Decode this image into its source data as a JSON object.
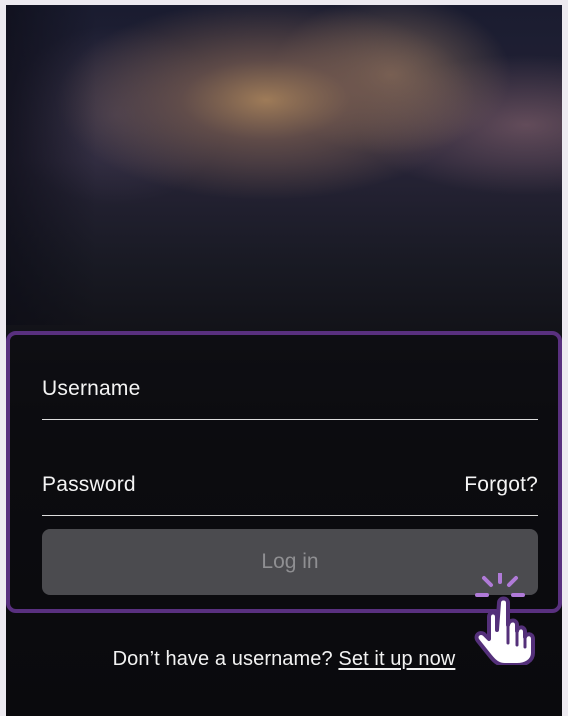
{
  "login": {
    "username_label": "Username",
    "password_label": "Password",
    "forgot_label": "Forgot?",
    "login_button_label": "Log in"
  },
  "signup": {
    "prompt_text": "Don’t have a username?",
    "link_text": "Set it up now"
  },
  "colors": {
    "highlight_border": "#59307f",
    "button_background": "#4b4b4f",
    "button_text": "#8f8f92",
    "text": "#f4f4f4"
  },
  "icons": {
    "cursor": "hand-pointer-icon",
    "click_effect": "click-burst-icon"
  }
}
